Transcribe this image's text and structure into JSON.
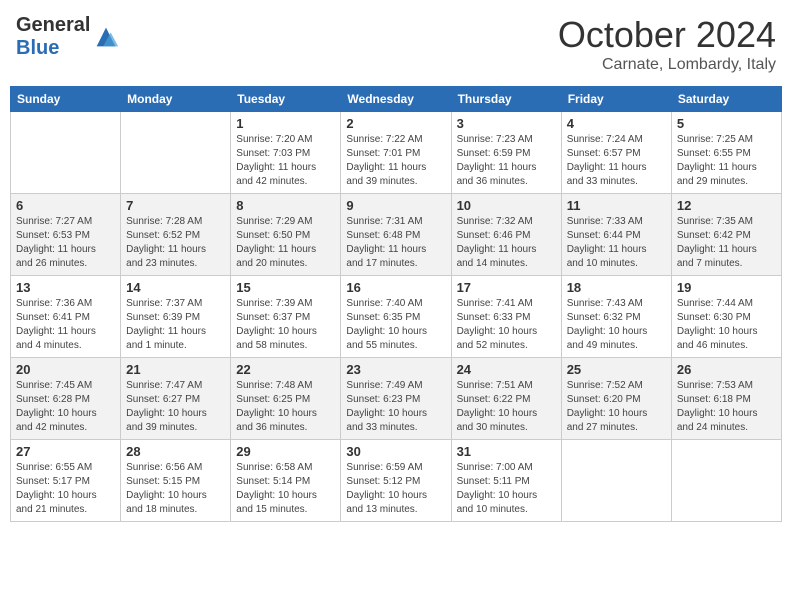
{
  "header": {
    "logo_general": "General",
    "logo_blue": "Blue",
    "month_title": "October 2024",
    "location": "Carnate, Lombardy, Italy"
  },
  "days_of_week": [
    "Sunday",
    "Monday",
    "Tuesday",
    "Wednesday",
    "Thursday",
    "Friday",
    "Saturday"
  ],
  "weeks": [
    [
      {
        "day": "",
        "info": ""
      },
      {
        "day": "",
        "info": ""
      },
      {
        "day": "1",
        "info": "Sunrise: 7:20 AM\nSunset: 7:03 PM\nDaylight: 11 hours and 42 minutes."
      },
      {
        "day": "2",
        "info": "Sunrise: 7:22 AM\nSunset: 7:01 PM\nDaylight: 11 hours and 39 minutes."
      },
      {
        "day": "3",
        "info": "Sunrise: 7:23 AM\nSunset: 6:59 PM\nDaylight: 11 hours and 36 minutes."
      },
      {
        "day": "4",
        "info": "Sunrise: 7:24 AM\nSunset: 6:57 PM\nDaylight: 11 hours and 33 minutes."
      },
      {
        "day": "5",
        "info": "Sunrise: 7:25 AM\nSunset: 6:55 PM\nDaylight: 11 hours and 29 minutes."
      }
    ],
    [
      {
        "day": "6",
        "info": "Sunrise: 7:27 AM\nSunset: 6:53 PM\nDaylight: 11 hours and 26 minutes."
      },
      {
        "day": "7",
        "info": "Sunrise: 7:28 AM\nSunset: 6:52 PM\nDaylight: 11 hours and 23 minutes."
      },
      {
        "day": "8",
        "info": "Sunrise: 7:29 AM\nSunset: 6:50 PM\nDaylight: 11 hours and 20 minutes."
      },
      {
        "day": "9",
        "info": "Sunrise: 7:31 AM\nSunset: 6:48 PM\nDaylight: 11 hours and 17 minutes."
      },
      {
        "day": "10",
        "info": "Sunrise: 7:32 AM\nSunset: 6:46 PM\nDaylight: 11 hours and 14 minutes."
      },
      {
        "day": "11",
        "info": "Sunrise: 7:33 AM\nSunset: 6:44 PM\nDaylight: 11 hours and 10 minutes."
      },
      {
        "day": "12",
        "info": "Sunrise: 7:35 AM\nSunset: 6:42 PM\nDaylight: 11 hours and 7 minutes."
      }
    ],
    [
      {
        "day": "13",
        "info": "Sunrise: 7:36 AM\nSunset: 6:41 PM\nDaylight: 11 hours and 4 minutes."
      },
      {
        "day": "14",
        "info": "Sunrise: 7:37 AM\nSunset: 6:39 PM\nDaylight: 11 hours and 1 minute."
      },
      {
        "day": "15",
        "info": "Sunrise: 7:39 AM\nSunset: 6:37 PM\nDaylight: 10 hours and 58 minutes."
      },
      {
        "day": "16",
        "info": "Sunrise: 7:40 AM\nSunset: 6:35 PM\nDaylight: 10 hours and 55 minutes."
      },
      {
        "day": "17",
        "info": "Sunrise: 7:41 AM\nSunset: 6:33 PM\nDaylight: 10 hours and 52 minutes."
      },
      {
        "day": "18",
        "info": "Sunrise: 7:43 AM\nSunset: 6:32 PM\nDaylight: 10 hours and 49 minutes."
      },
      {
        "day": "19",
        "info": "Sunrise: 7:44 AM\nSunset: 6:30 PM\nDaylight: 10 hours and 46 minutes."
      }
    ],
    [
      {
        "day": "20",
        "info": "Sunrise: 7:45 AM\nSunset: 6:28 PM\nDaylight: 10 hours and 42 minutes."
      },
      {
        "day": "21",
        "info": "Sunrise: 7:47 AM\nSunset: 6:27 PM\nDaylight: 10 hours and 39 minutes."
      },
      {
        "day": "22",
        "info": "Sunrise: 7:48 AM\nSunset: 6:25 PM\nDaylight: 10 hours and 36 minutes."
      },
      {
        "day": "23",
        "info": "Sunrise: 7:49 AM\nSunset: 6:23 PM\nDaylight: 10 hours and 33 minutes."
      },
      {
        "day": "24",
        "info": "Sunrise: 7:51 AM\nSunset: 6:22 PM\nDaylight: 10 hours and 30 minutes."
      },
      {
        "day": "25",
        "info": "Sunrise: 7:52 AM\nSunset: 6:20 PM\nDaylight: 10 hours and 27 minutes."
      },
      {
        "day": "26",
        "info": "Sunrise: 7:53 AM\nSunset: 6:18 PM\nDaylight: 10 hours and 24 minutes."
      }
    ],
    [
      {
        "day": "27",
        "info": "Sunrise: 6:55 AM\nSunset: 5:17 PM\nDaylight: 10 hours and 21 minutes."
      },
      {
        "day": "28",
        "info": "Sunrise: 6:56 AM\nSunset: 5:15 PM\nDaylight: 10 hours and 18 minutes."
      },
      {
        "day": "29",
        "info": "Sunrise: 6:58 AM\nSunset: 5:14 PM\nDaylight: 10 hours and 15 minutes."
      },
      {
        "day": "30",
        "info": "Sunrise: 6:59 AM\nSunset: 5:12 PM\nDaylight: 10 hours and 13 minutes."
      },
      {
        "day": "31",
        "info": "Sunrise: 7:00 AM\nSunset: 5:11 PM\nDaylight: 10 hours and 10 minutes."
      },
      {
        "day": "",
        "info": ""
      },
      {
        "day": "",
        "info": ""
      }
    ]
  ]
}
